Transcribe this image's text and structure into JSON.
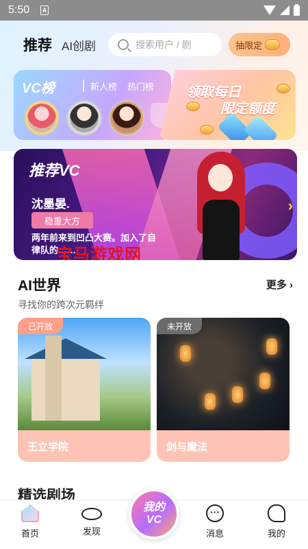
{
  "status_bar": {
    "time": "5:50",
    "sim_label": "A"
  },
  "header": {
    "tab_recommend": "推荐",
    "tab_ai_drama": "AI创剧",
    "search_placeholder": "搜索用户 / 剧",
    "lottery_label": "抽限定"
  },
  "rank_card": {
    "title": "VC榜",
    "tab_new": "新人榜",
    "tab_hot": "热门榜"
  },
  "daily_card": {
    "line1": "领取每日",
    "line2": "限定额度"
  },
  "banner": {
    "title": "推荐VC",
    "character_name": "沈墨晏.",
    "tag": "稳重大方",
    "description": "两年前来到凹凸大赛。加入了自律队的……",
    "watermark": "宝马游戏网"
  },
  "ai_world": {
    "title": "AI世界",
    "more": "更多",
    "subtitle": "寻找你的跨次元羁绊",
    "cards": [
      {
        "badge": "已开放",
        "name": "王立学院"
      },
      {
        "badge": "未开放",
        "name": "剑与魔法"
      }
    ],
    "next_section_peek": "精选剧场"
  },
  "bottom_nav": {
    "items": [
      {
        "label": "首页",
        "icon": "home-icon"
      },
      {
        "label": "发现",
        "icon": "planet-icon"
      },
      {
        "label": "消息",
        "icon": "message-icon"
      },
      {
        "label": "我的",
        "icon": "profile-icon"
      }
    ],
    "center_line1": "我的",
    "center_line2": "VC"
  }
}
